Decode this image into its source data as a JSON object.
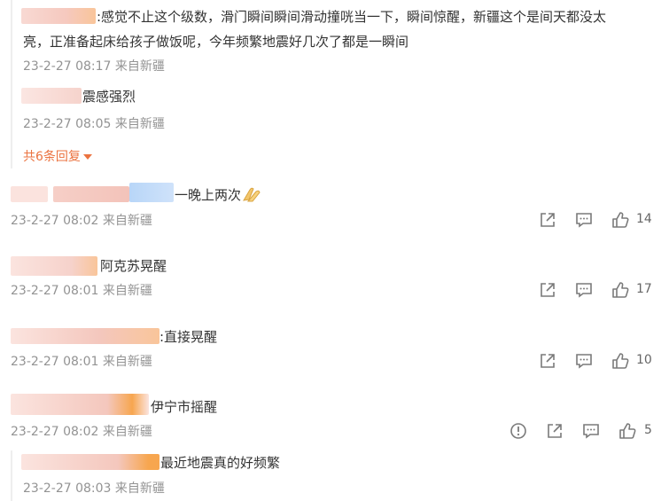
{
  "replies_top": [
    {
      "text_line1": ":感觉不止这个级数，滑门瞬间瞬间滑动撞咣当一下，瞬间惊醒，新疆这个是间天都没太",
      "text_line2": "亮，正准备起床给孩子做饭呢，今年频繁地震好几次了都是一瞬间",
      "meta": "23-2-27 08:17 来自新疆"
    },
    {
      "text": "震感强烈",
      "meta": "23-2-27 08:05 来自新疆"
    }
  ],
  "more_replies": "共6条回复",
  "comments": [
    {
      "text": "一晚上两次",
      "meta": "23-2-27 08:02 来自新疆",
      "likes": "14",
      "emoji": "praying-hands"
    },
    {
      "text": "阿克苏晃醒",
      "meta": "23-2-27 08:01 来自新疆",
      "likes": "17"
    },
    {
      "text": ":直接晃醒",
      "meta": "23-2-27 08:01 来自新疆",
      "likes": "10"
    },
    {
      "text": "伊宁市摇醒",
      "meta": "23-2-27 08:02 来自新疆",
      "likes": "5"
    }
  ],
  "reply_bottom": {
    "text": "最近地震真的好频繁",
    "meta": "23-2-27 08:03 来自新疆"
  },
  "colors": {
    "meta": "#939393",
    "accent": "#eb7340",
    "icon": "#7a7a7a"
  },
  "icons": [
    "share-icon",
    "comment-icon",
    "like-icon",
    "report-icon"
  ]
}
